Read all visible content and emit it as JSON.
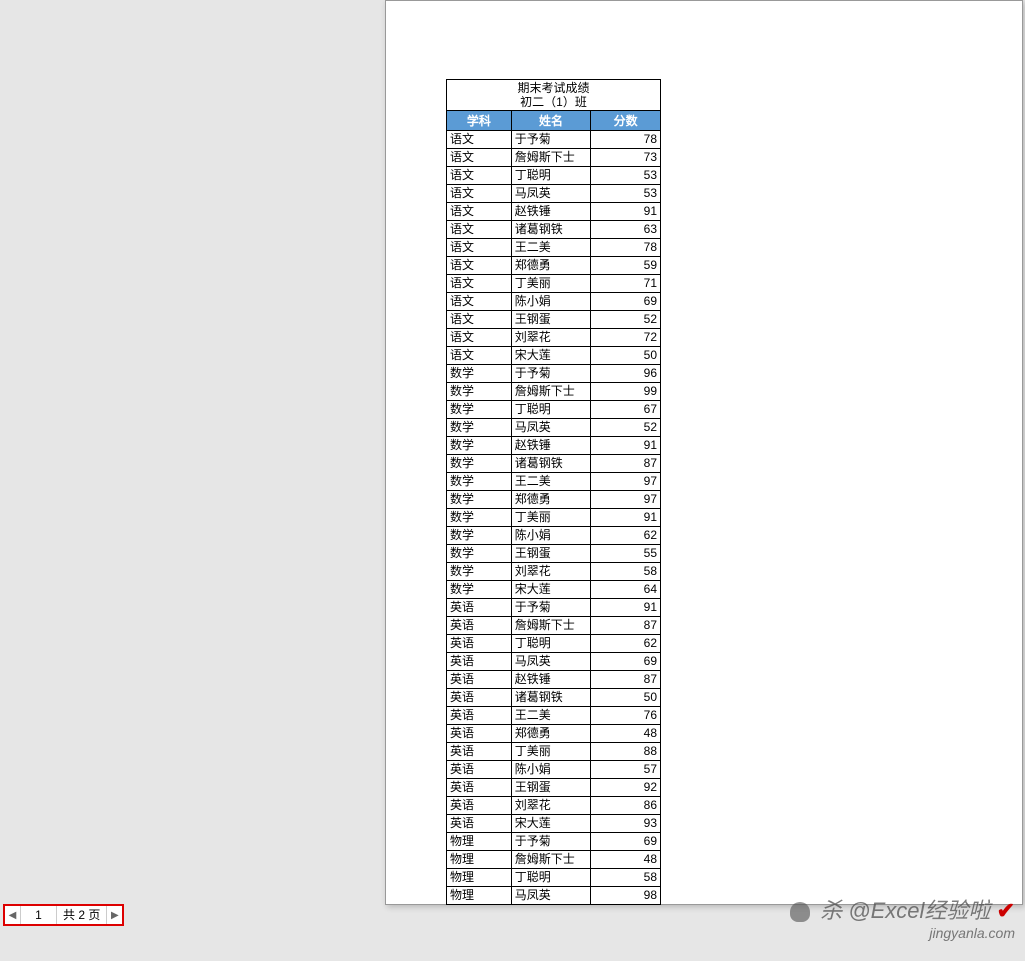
{
  "title_line1": "期末考试成绩",
  "title_line2": "初二（1）班",
  "headers": {
    "subject": "学科",
    "name": "姓名",
    "score": "分数"
  },
  "rows": [
    {
      "s": "语文",
      "n": "于予菊",
      "v": 78
    },
    {
      "s": "语文",
      "n": "詹姆斯下士",
      "v": 73
    },
    {
      "s": "语文",
      "n": "丁聪明",
      "v": 53
    },
    {
      "s": "语文",
      "n": "马凤英",
      "v": 53
    },
    {
      "s": "语文",
      "n": "赵铁锤",
      "v": 91
    },
    {
      "s": "语文",
      "n": "诸葛钢铁",
      "v": 63
    },
    {
      "s": "语文",
      "n": "王二美",
      "v": 78
    },
    {
      "s": "语文",
      "n": "郑德勇",
      "v": 59
    },
    {
      "s": "语文",
      "n": "丁美丽",
      "v": 71
    },
    {
      "s": "语文",
      "n": "陈小娟",
      "v": 69
    },
    {
      "s": "语文",
      "n": "王钢蛋",
      "v": 52
    },
    {
      "s": "语文",
      "n": "刘翠花",
      "v": 72
    },
    {
      "s": "语文",
      "n": "宋大莲",
      "v": 50
    },
    {
      "s": "数学",
      "n": "于予菊",
      "v": 96
    },
    {
      "s": "数学",
      "n": "詹姆斯下士",
      "v": 99
    },
    {
      "s": "数学",
      "n": "丁聪明",
      "v": 67
    },
    {
      "s": "数学",
      "n": "马凤英",
      "v": 52
    },
    {
      "s": "数学",
      "n": "赵铁锤",
      "v": 91
    },
    {
      "s": "数学",
      "n": "诸葛钢铁",
      "v": 87
    },
    {
      "s": "数学",
      "n": "王二美",
      "v": 97
    },
    {
      "s": "数学",
      "n": "郑德勇",
      "v": 97
    },
    {
      "s": "数学",
      "n": "丁美丽",
      "v": 91
    },
    {
      "s": "数学",
      "n": "陈小娟",
      "v": 62
    },
    {
      "s": "数学",
      "n": "王钢蛋",
      "v": 55
    },
    {
      "s": "数学",
      "n": "刘翠花",
      "v": 58
    },
    {
      "s": "数学",
      "n": "宋大莲",
      "v": 64
    },
    {
      "s": "英语",
      "n": "于予菊",
      "v": 91
    },
    {
      "s": "英语",
      "n": "詹姆斯下士",
      "v": 87
    },
    {
      "s": "英语",
      "n": "丁聪明",
      "v": 62
    },
    {
      "s": "英语",
      "n": "马凤英",
      "v": 69
    },
    {
      "s": "英语",
      "n": "赵铁锤",
      "v": 87
    },
    {
      "s": "英语",
      "n": "诸葛钢铁",
      "v": 50
    },
    {
      "s": "英语",
      "n": "王二美",
      "v": 76
    },
    {
      "s": "英语",
      "n": "郑德勇",
      "v": 48
    },
    {
      "s": "英语",
      "n": "丁美丽",
      "v": 88
    },
    {
      "s": "英语",
      "n": "陈小娟",
      "v": 57
    },
    {
      "s": "英语",
      "n": "王钢蛋",
      "v": 92
    },
    {
      "s": "英语",
      "n": "刘翠花",
      "v": 86
    },
    {
      "s": "英语",
      "n": "宋大莲",
      "v": 93
    },
    {
      "s": "物理",
      "n": "于予菊",
      "v": 69
    },
    {
      "s": "物理",
      "n": "詹姆斯下士",
      "v": 48
    },
    {
      "s": "物理",
      "n": "丁聪明",
      "v": 58
    },
    {
      "s": "物理",
      "n": "马凤英",
      "v": 98
    }
  ],
  "pager": {
    "current": "1",
    "total_text": "共 2 页",
    "prev": "◀",
    "next": "▶"
  },
  "watermark": {
    "line1_prefix": "杀 @Excel经验啦",
    "check": "✔",
    "line2": "jingyanla.com"
  }
}
